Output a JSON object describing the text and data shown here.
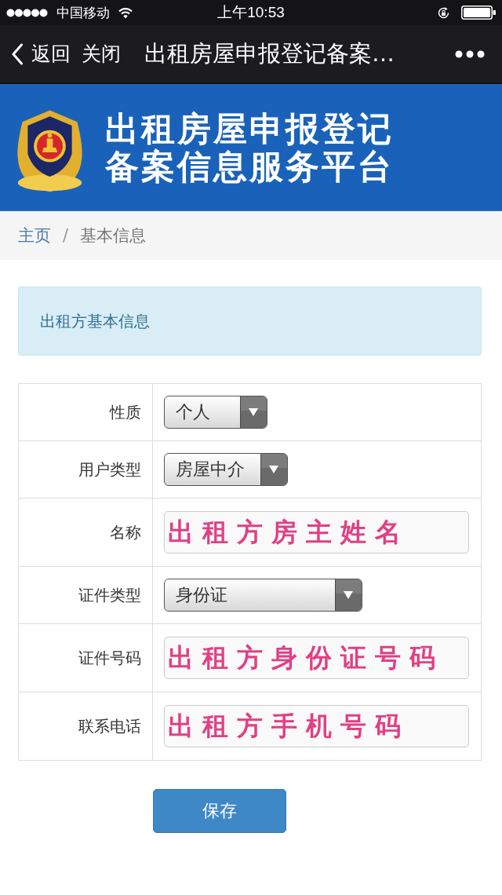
{
  "status_bar": {
    "carrier": "中国移动",
    "time": "上午10:53"
  },
  "nav_bar": {
    "back": "返回",
    "close": "关闭",
    "title": "出租房屋申报登记备案…"
  },
  "banner": {
    "title_lines": [
      "出租房屋申报登记",
      "备案信息服务平台"
    ]
  },
  "breadcrumb": {
    "items": [
      {
        "label": "主页",
        "selected": false
      },
      {
        "label": "基本信息",
        "selected": true
      }
    ],
    "separator": "/"
  },
  "section_header": "出租方基本信息",
  "form": {
    "rows": [
      {
        "label": "性质",
        "kind": "select",
        "value": "个人"
      },
      {
        "label": "用户类型",
        "kind": "select",
        "value": "房屋中介"
      },
      {
        "label": "名称",
        "kind": "text",
        "value": "出租方房主姓名"
      },
      {
        "label": "证件类型",
        "kind": "select",
        "value": "身份证"
      },
      {
        "label": "证件号码",
        "kind": "text",
        "value": "出租方身份证号码"
      },
      {
        "label": "联系电话",
        "kind": "text",
        "value": "出租方手机号码"
      }
    ]
  },
  "save_button": "保存"
}
